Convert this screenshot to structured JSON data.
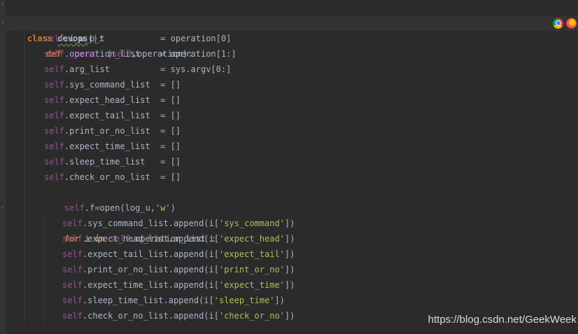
{
  "code": {
    "line_class": {
      "kw": "class",
      "name": "devops",
      "rest": "():"
    },
    "line_def": {
      "kw": "def",
      "name": "__init__",
      "p1": "(",
      "self": "self",
      "rest": ",operation):"
    },
    "assign_lines": [
      {
        "self": "self",
        "text": ".i_u_p_t           = operation[0]"
      },
      {
        "self": "self",
        "text": ".operation_list    = operation[1:]"
      },
      {
        "self": "self",
        "text": ".arg_list          = sys.argv[0:]"
      },
      {
        "self": "self",
        "text": ".sys_command_list  = []"
      },
      {
        "self": "self",
        "text": ".expect_head_list  = []"
      },
      {
        "self": "self",
        "text": ".expect_tail_list  = []"
      },
      {
        "self": "self",
        "text": ".print_or_no_list  = []"
      },
      {
        "self": "self",
        "text": ".expect_time_list  = []"
      },
      {
        "self": "self",
        "text": ".sleep_time_list   = []"
      },
      {
        "self": "self",
        "text": ".check_or_no_list  = []"
      }
    ],
    "line_open": {
      "self": "self",
      "a": ".f=",
      "fn": "open",
      "b": "(log_u,",
      "str": "'w'",
      "c": ")"
    },
    "line_for": {
      "kw1": "for",
      "i": " i ",
      "kw2": "in",
      "sp": " ",
      "self": "self",
      "rest": ".operation_list :"
    },
    "append_lines": [
      {
        "self": "self",
        "a": ".sys_command_list.append(i[",
        "str": "'sys_command'",
        "b": "])"
      },
      {
        "self": "self",
        "a": ".expect_head_list.append(i[",
        "str": "'expect_head'",
        "b": "])"
      },
      {
        "self": "self",
        "a": ".expect_tail_list.append(i[",
        "str": "'expect_tail'",
        "b": "])"
      },
      {
        "self": "self",
        "a": ".print_or_no_list.append(i[",
        "str": "'print_or_no'",
        "b": "])"
      },
      {
        "self": "self",
        "a": ".expect_time_list.append(i[",
        "str": "'expect_time'",
        "b": "])"
      },
      {
        "self": "self",
        "a": ".sleep_time_list.append(i[",
        "str": "'sleep_time'",
        "b": "])"
      },
      {
        "self": "self",
        "a": ".check_or_no_list.append(i[",
        "str": "'check_or_no'",
        "b": "])"
      }
    ]
  },
  "watermark": "https://blog.csdn.net/GeekWeek",
  "icons": [
    "chrome-icon",
    "firefox-icon"
  ],
  "colors": {
    "background": "#2b2b2b",
    "keyword": "#cc7832",
    "self": "#94558d",
    "string": "#a5c25c",
    "text": "#a9b7c6"
  }
}
